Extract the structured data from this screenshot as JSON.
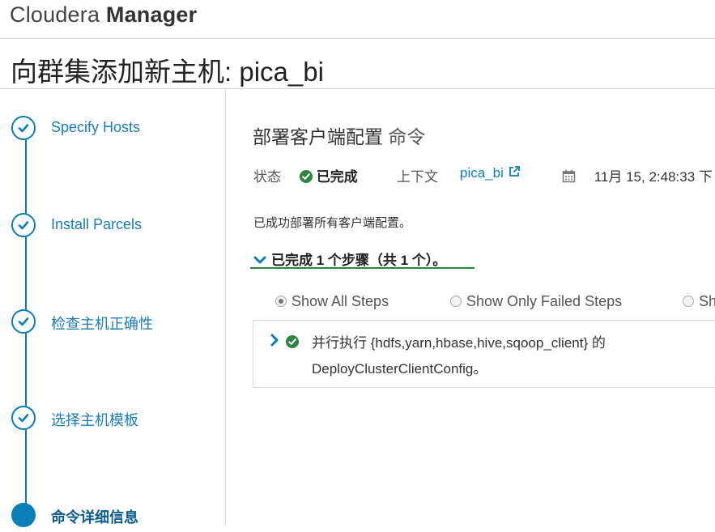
{
  "brand": {
    "name_light": "Cloudera ",
    "name_bold": "Manager"
  },
  "page": {
    "title": "向群集添加新主机: pica_bi"
  },
  "wizard": {
    "steps": [
      {
        "label": "Specify Hosts",
        "state": "done"
      },
      {
        "label": "Install Parcels",
        "state": "done"
      },
      {
        "label": "检查主机正确性",
        "state": "done"
      },
      {
        "label": "选择主机模板",
        "state": "done"
      },
      {
        "label": "命令详细信息",
        "state": "active"
      }
    ]
  },
  "command": {
    "title": "部署客户端配置",
    "title_suffix": "命令",
    "status_label": "状态",
    "status_value": "已完成",
    "context_label": "上下文",
    "context_value": "pica_bi",
    "timestamp": "11月 15, 2:48:33 下",
    "message": "已成功部署所有客户端配置。",
    "steps_summary": "已完成 1 个步骤（共 1 个）。"
  },
  "filters": {
    "show_all": "Show All Steps",
    "show_failed": "Show Only Failed Steps",
    "show_running": "Sh",
    "selected": "show_all"
  },
  "step_detail": {
    "line1": "并行执行 {hdfs,yarn,hbase,hive,sqoop_client} 的",
    "line2": "DeployClusterClientConfig。"
  },
  "colors": {
    "accent": "#0a7fb7",
    "success": "#2e8540",
    "divider": "#d6d6d6"
  },
  "icons": [
    "check-icon",
    "external-link-icon",
    "calendar-icon",
    "chevron-down-icon",
    "chevron-right-icon"
  ]
}
